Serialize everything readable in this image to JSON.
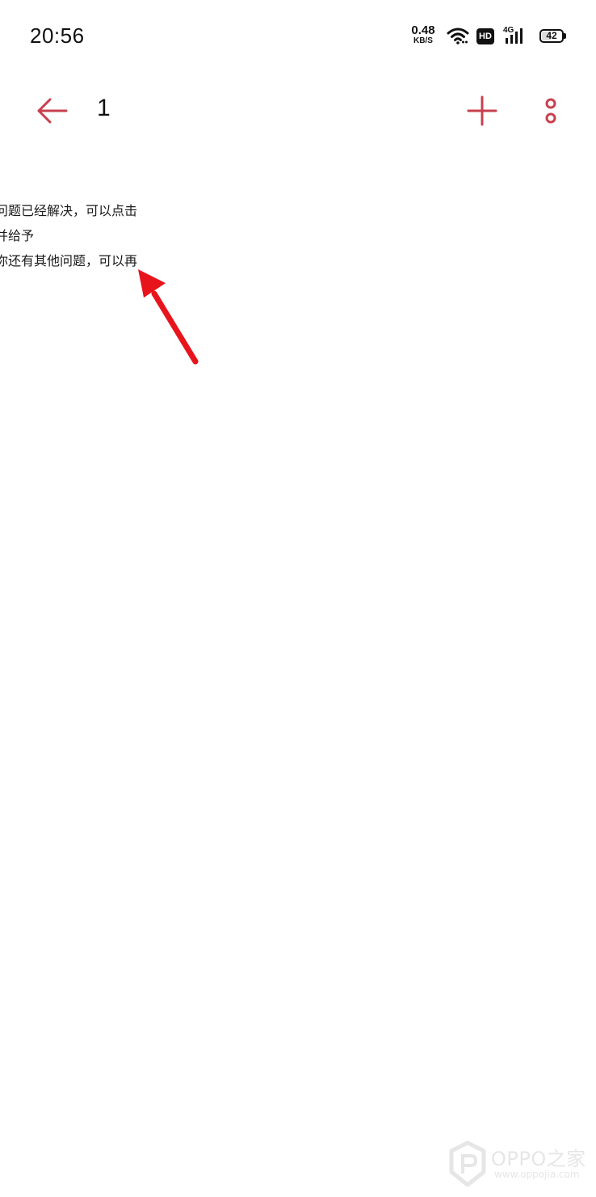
{
  "status_bar": {
    "time": "20:56",
    "net_speed_value": "0.48",
    "net_speed_unit": "KB/S",
    "hd_label": "HD",
    "network_label": "4G",
    "battery_level": "42"
  },
  "title_bar": {
    "title": "1"
  },
  "content": {
    "lines": [
      "问题已经解决，可以点击",
      "并给予",
      "你还有其他问题，可以再"
    ]
  },
  "watermark": {
    "text": "OPPO之家",
    "url": "www.oppojia.com"
  },
  "colors": {
    "accent": "#c8404f",
    "annotation": "#e8141c"
  },
  "icons": {
    "back": "arrow-left-icon",
    "add": "plus-icon",
    "more": "more-vertical-icon",
    "wifi": "wifi-icon",
    "signal": "signal-icon",
    "battery": "battery-icon"
  }
}
